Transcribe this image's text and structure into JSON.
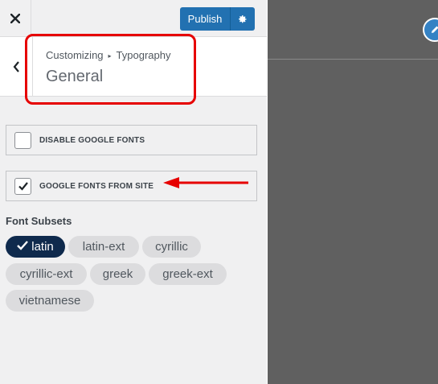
{
  "topbar": {
    "close_icon": "close-icon",
    "publish_label": "Publish",
    "settings_icon": "gear-icon"
  },
  "header": {
    "breadcrumb_root": "Customizing",
    "breadcrumb_section": "Typography",
    "title": "General"
  },
  "controls": [
    {
      "label": "DISABLE GOOGLE FONTS",
      "checked": false
    },
    {
      "label": "GOOGLE FONTS FROM SITE",
      "checked": true
    }
  ],
  "font_subsets": {
    "title": "Font Subsets",
    "items": [
      {
        "label": "latin",
        "selected": true
      },
      {
        "label": "latin-ext",
        "selected": false
      },
      {
        "label": "cyrillic",
        "selected": false
      },
      {
        "label": "cyrillic-ext",
        "selected": false
      },
      {
        "label": "greek",
        "selected": false
      },
      {
        "label": "greek-ext",
        "selected": false
      },
      {
        "label": "vietnamese",
        "selected": false
      }
    ]
  },
  "colors": {
    "accent": "#2271b1",
    "highlight": "#e60000",
    "selected_pill": "#0f2a4d"
  }
}
